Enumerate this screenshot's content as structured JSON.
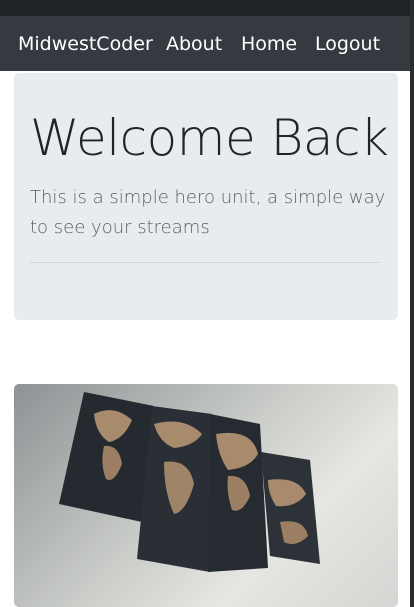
{
  "navbar": {
    "brand": "MidwestCoder",
    "links": [
      "About",
      "Home",
      "Logout"
    ]
  },
  "hero": {
    "title": "Welcome Back",
    "lead": "This is a simple hero unit, a simple way to see your streams"
  },
  "colors": {
    "navbar": "#343a40",
    "jumbotron": "#e9ecef"
  },
  "stream": {
    "image_icon": "world-map-canvas-photo"
  }
}
